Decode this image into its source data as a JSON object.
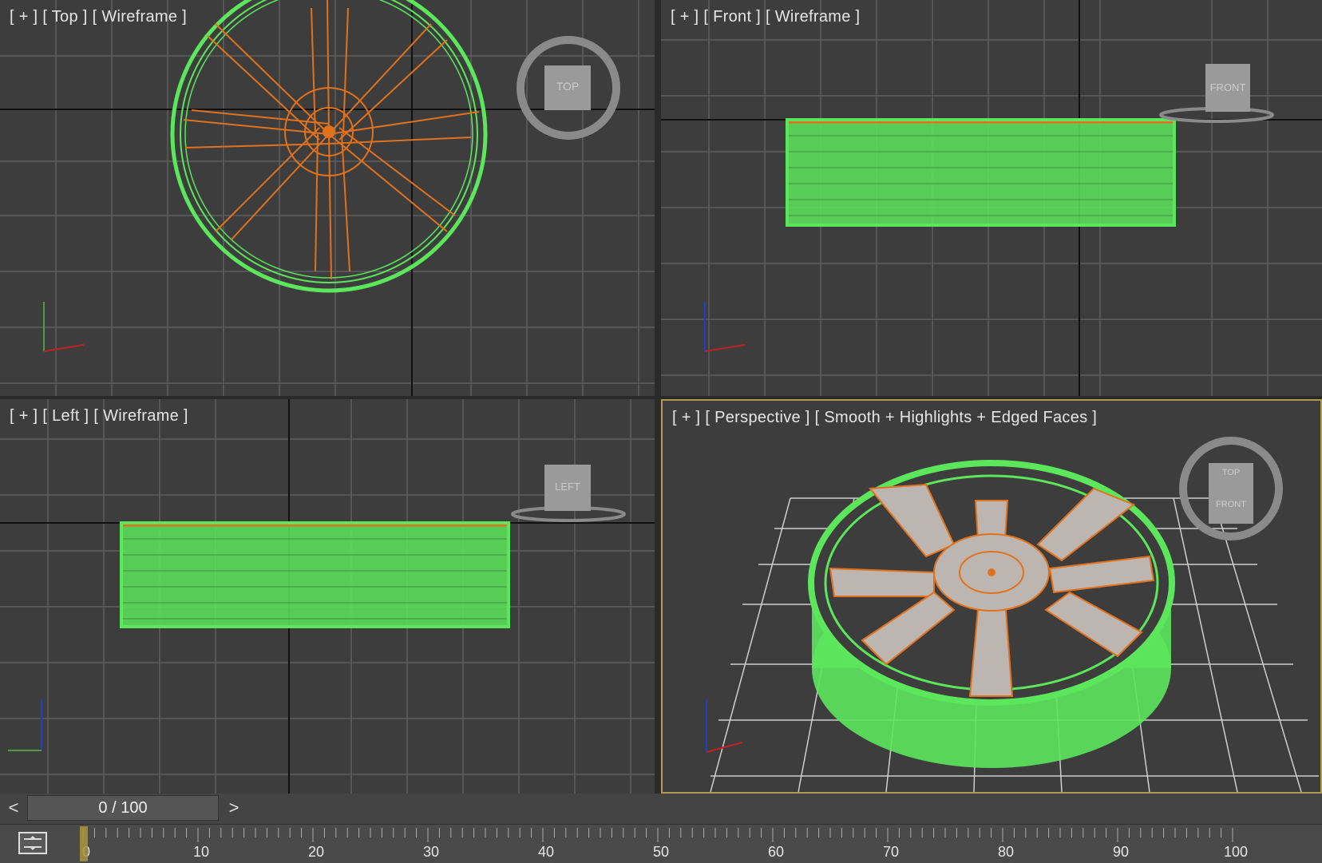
{
  "viewports": [
    {
      "id": "top",
      "plus": "[ + ]",
      "view": "[ Top ]",
      "shading": "[ Wireframe ]",
      "cube_label": "TOP",
      "active": false
    },
    {
      "id": "front",
      "plus": "[ + ]",
      "view": "[ Front ]",
      "shading": "[ Wireframe ]",
      "cube_label": "FRONT",
      "active": false
    },
    {
      "id": "left",
      "plus": "[ + ]",
      "view": "[ Left ]",
      "shading": "[ Wireframe ]",
      "cube_label": "LEFT",
      "active": false
    },
    {
      "id": "perspective",
      "plus": "[ + ]",
      "view": "[ Perspective ]",
      "shading": "[ Smooth + Highlights + Edged Faces ]",
      "cube_label": "TOP",
      "cube_label2": "FRONT",
      "active": true
    }
  ],
  "time_slider": {
    "prev": "<",
    "next": ">",
    "frame": "0 / 100",
    "current": 0,
    "total": 100
  },
  "timeline": {
    "ticks": [
      "0",
      "10",
      "20",
      "30",
      "40",
      "50",
      "60",
      "70",
      "80",
      "90",
      "100"
    ],
    "icon": "key-mode-icon"
  },
  "colors": {
    "viewport_bg": "#3d3d3d",
    "grid": "#5e5e5e",
    "grid_main": "#111111",
    "mesh_green": "#5ce65c",
    "mesh_orange": "#e0721e",
    "active_border": "#b39a52"
  }
}
